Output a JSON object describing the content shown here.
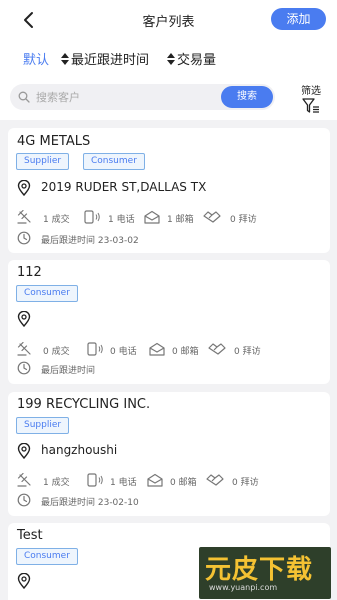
{
  "header": {
    "title": "客户列表",
    "add_label": "添加"
  },
  "sort": {
    "default_label": "默认",
    "recent_label": "最近跟进时间",
    "volume_label": "交易量"
  },
  "search": {
    "placeholder": "搜索客户",
    "button_label": "搜索",
    "filter_label": "筛选"
  },
  "customers": [
    {
      "name": "4G METALS",
      "tags": [
        "Supplier",
        "Consumer"
      ],
      "address": "2019 RUDER ST,DALLAS TX",
      "deals": "1 成交",
      "calls": "1 电话",
      "emails": "1 邮箱",
      "visits": "0 拜访",
      "last_followup": "最后跟进时间 23-03-02"
    },
    {
      "name": "112",
      "tags": [
        "Consumer"
      ],
      "address": "",
      "deals": "0 成交",
      "calls": "0 电话",
      "emails": "0 邮箱",
      "visits": "0 拜访",
      "last_followup": "最后跟进时间"
    },
    {
      "name": "199 RECYCLING INC.",
      "tags": [
        "Supplier"
      ],
      "address": "hangzhoushi",
      "deals": "1 成交",
      "calls": "1 电话",
      "emails": "0 邮箱",
      "visits": "0 拜访",
      "last_followup": "最后跟进时间 23-02-10"
    },
    {
      "name": "Test",
      "tags": [
        "Consumer"
      ],
      "address": ""
    }
  ],
  "watermark": {
    "brand": "元皮下载",
    "url": "www.yuanpi.com"
  },
  "colors": {
    "accent": "#4a7cf0",
    "tag_border": "#7fb0e6",
    "background": "#f2f2f4"
  }
}
